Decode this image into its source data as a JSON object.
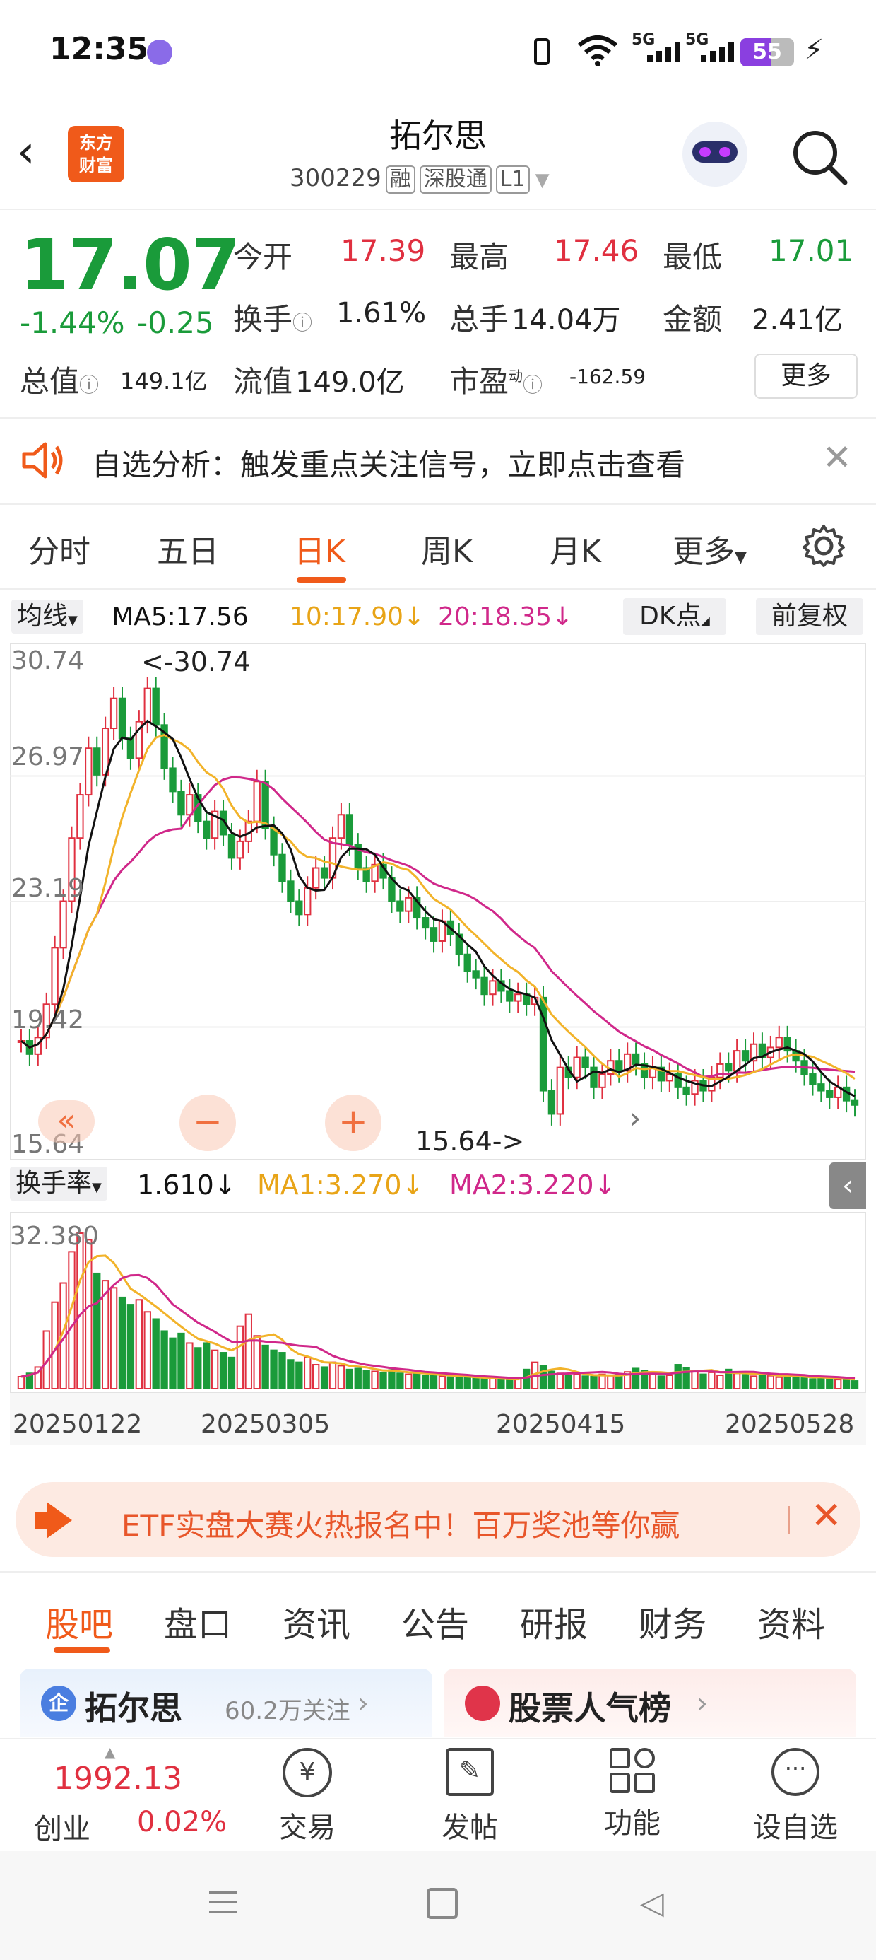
{
  "status_bar": {
    "time": "12:35",
    "network": "5G",
    "battery": "55"
  },
  "header": {
    "logo_line1": "东方",
    "logo_line2": "财富",
    "title": "拓尔思",
    "code": "300229",
    "tags": [
      "融",
      "深股通",
      "L1"
    ]
  },
  "quote": {
    "price": "17.07",
    "change_pct": "-1.44%",
    "change": "-0.25",
    "open_label": "今开",
    "open": "17.39",
    "high_label": "最高",
    "high": "17.46",
    "low_label": "最低",
    "low": "17.01",
    "turnover_label": "换手",
    "turnover": "1.61%",
    "volume_label": "总手",
    "volume": "14.04万",
    "amount_label": "金额",
    "amount": "2.41亿",
    "mktcap_label": "总值",
    "mktcap": "149.1亿",
    "float_label": "流值",
    "float": "149.0亿",
    "pe_label": "市盈",
    "pe_sup": "动",
    "pe": "-162.59",
    "more_button": "更多"
  },
  "notice": {
    "text": "自选分析：触发重点关注信号，立即点击查看"
  },
  "chart_tabs": {
    "items": [
      "分时",
      "五日",
      "日K",
      "周K",
      "月K",
      "更多"
    ],
    "active": "日K"
  },
  "ma_bar": {
    "selector": "均线",
    "ma5": "MA5:17.56",
    "ma10": "10:17.90",
    "ma20": "20:18.35",
    "dk_button": "DK点",
    "adjust_button": "前复权"
  },
  "kline": {
    "y_labels": [
      "30.74",
      "26.97",
      "23.19",
      "19.42",
      "15.64"
    ],
    "max_marker": "<-30.74",
    "min_marker": "15.64->"
  },
  "turnover_bar": {
    "selector": "换手率",
    "value": "1.610",
    "ma1": "MA1:3.270",
    "ma2": "MA2:3.220",
    "top_label": "32.380"
  },
  "dates": [
    "20250122",
    "20250305",
    "20250415",
    "20250528"
  ],
  "colors": {
    "up": "#e03040",
    "down": "#1a9b3a",
    "ma5": "#111111",
    "ma10": "#f2b32a",
    "ma20": "#d0288a",
    "accent": "#f05a1a"
  },
  "chart_data": {
    "type": "candlestick",
    "ylim": [
      15.64,
      30.74
    ],
    "series": [
      {
        "name": "MA5",
        "value": 17.56
      },
      {
        "name": "MA10",
        "value": 17.9
      },
      {
        "name": "MA20",
        "value": 18.35
      }
    ],
    "closes": [
      19.0,
      18.6,
      19.1,
      20.1,
      21.8,
      23.2,
      25.1,
      26.4,
      27.8,
      27.0,
      28.4,
      29.3,
      28.1,
      27.5,
      28.6,
      29.6,
      28.5,
      27.2,
      26.5,
      25.8,
      26.4,
      25.6,
      25.1,
      25.9,
      25.2,
      24.5,
      25.0,
      25.6,
      26.8,
      25.4,
      24.6,
      23.8,
      23.2,
      22.8,
      23.6,
      24.2,
      23.9,
      25.1,
      25.8,
      24.9,
      24.2,
      23.8,
      24.3,
      23.9,
      23.2,
      22.9,
      23.3,
      22.7,
      22.4,
      22.0,
      22.6,
      22.2,
      21.6,
      21.1,
      20.9,
      20.4,
      20.8,
      20.5,
      20.2,
      20.4,
      20.1,
      20.3,
      17.5,
      16.8,
      18.2,
      17.9,
      18.5,
      18.2,
      17.6,
      18.0,
      18.4,
      18.1,
      18.6,
      18.3,
      17.9,
      18.2,
      17.8,
      18.0,
      17.6,
      17.4,
      17.8,
      17.5,
      17.9,
      18.3,
      18.1,
      18.7,
      18.4,
      18.9,
      18.5,
      18.8,
      19.1,
      18.7,
      18.4,
      18.0,
      17.7,
      17.5,
      17.3,
      17.6,
      17.2,
      17.07
    ],
    "turnover": [
      2.5,
      3.2,
      4.5,
      12.0,
      18.0,
      22.0,
      28.5,
      32.38,
      31.0,
      24.0,
      22.5,
      21.0,
      19.0,
      17.5,
      18.5,
      16.0,
      14.5,
      12.0,
      10.5,
      11.5,
      9.5,
      8.5,
      9.5,
      8.0,
      7.5,
      6.5,
      13.0,
      15.5,
      11.0,
      9.0,
      8.0,
      7.5,
      6.0,
      5.5,
      6.5,
      5.0,
      4.5,
      5.5,
      4.8,
      4.0,
      4.2,
      3.8,
      3.6,
      3.4,
      3.9,
      3.2,
      3.0,
      3.1,
      2.8,
      2.9,
      2.6,
      2.4,
      2.5,
      2.3,
      2.2,
      2.0,
      2.1,
      1.9,
      1.8,
      2.0,
      4.0,
      5.5,
      4.8,
      3.6,
      3.2,
      2.8,
      3.0,
      2.6,
      2.5,
      3.0,
      2.7,
      2.9,
      3.5,
      4.2,
      3.8,
      3.0,
      2.6,
      2.8,
      5.0,
      4.4,
      3.6,
      3.0,
      3.4,
      2.8,
      4.0,
      3.2,
      2.9,
      2.6,
      3.1,
      2.7,
      2.4,
      2.8,
      2.5,
      2.2,
      2.0,
      2.4,
      2.1,
      1.9,
      1.8,
      1.61
    ],
    "dates": [
      "20250122",
      "20250305",
      "20250415",
      "20250528"
    ]
  },
  "ad_banner": {
    "text": "ETF实盘大赛火热报名中！百万奖池等你赢"
  },
  "bottom_tabs": {
    "items": [
      "股吧",
      "盘口",
      "资讯",
      "公告",
      "研报",
      "财务",
      "资料"
    ],
    "active": "股吧"
  },
  "cards": {
    "stock_name": "拓尔思",
    "followers": "60.2万关注",
    "rank": "股票人气榜"
  },
  "footer": {
    "index_value": "1992.13",
    "index_name": "创业",
    "index_change": "0.02%",
    "items": [
      "交易",
      "发帖",
      "功能",
      "设自选"
    ]
  }
}
